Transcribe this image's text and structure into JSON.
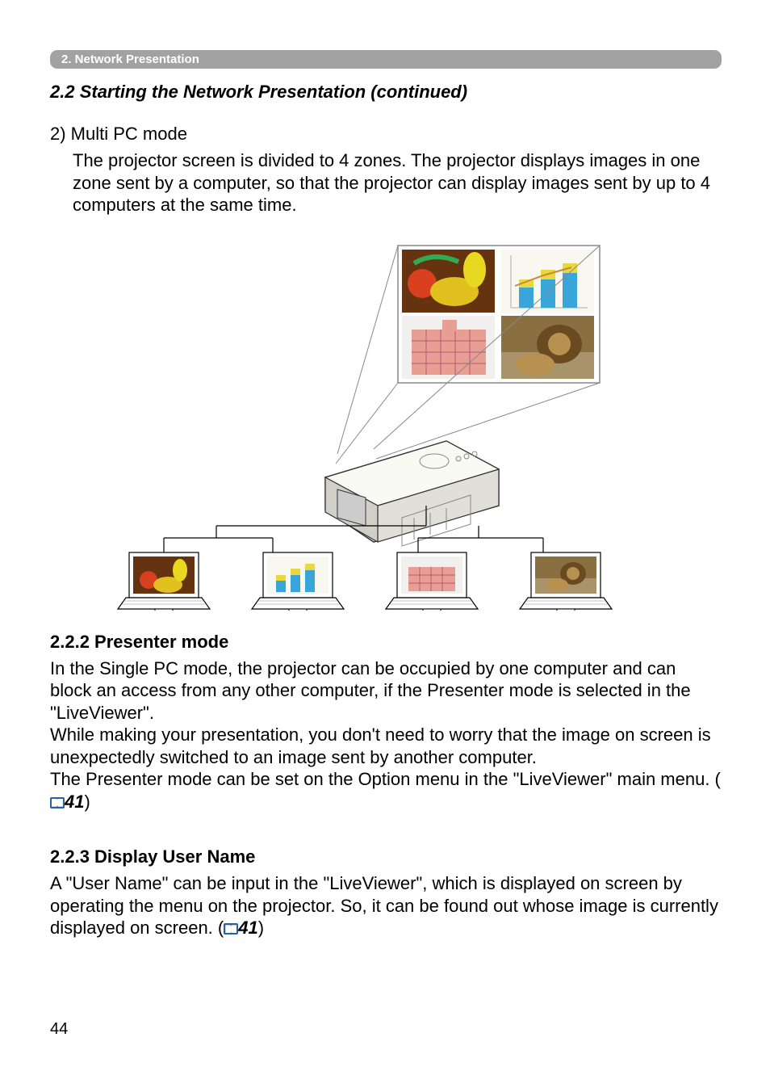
{
  "headerBar": "2. Network Presentation",
  "sectionTitle": "2.2 Starting the Network Presentation (continued)",
  "multiPc": {
    "label": "2) Multi PC mode",
    "body": "The projector screen is divided to 4 zones. The projector displays images in one zone sent by a computer, so that the projector can display images sent by up to 4 computers at the same time."
  },
  "presenterMode": {
    "heading": "2.2.2 Presenter mode",
    "para1": "In the Single PC mode, the projector can be occupied by one computer and can block an access from any other computer, if the Presenter mode is selected in the \"LiveViewer\".",
    "para2": "While making your presentation, you don't need to worry that the image on screen is unexpectedly switched to an image sent by another computer.",
    "para3a": "The Presenter mode can be set on the Option menu in the \"LiveViewer\" main menu. (",
    "ref1": "41",
    "para3b": ")"
  },
  "displayUserName": {
    "heading": "2.2.3 Display User Name",
    "para1a": "A \"User Name\" can be input in the \"LiveViewer\", which is displayed on screen by operating the menu on the projector. So, it can be found out whose image is currently displayed on screen. (",
    "ref1": "41",
    "para1b": ")"
  },
  "pageNumber": "44"
}
